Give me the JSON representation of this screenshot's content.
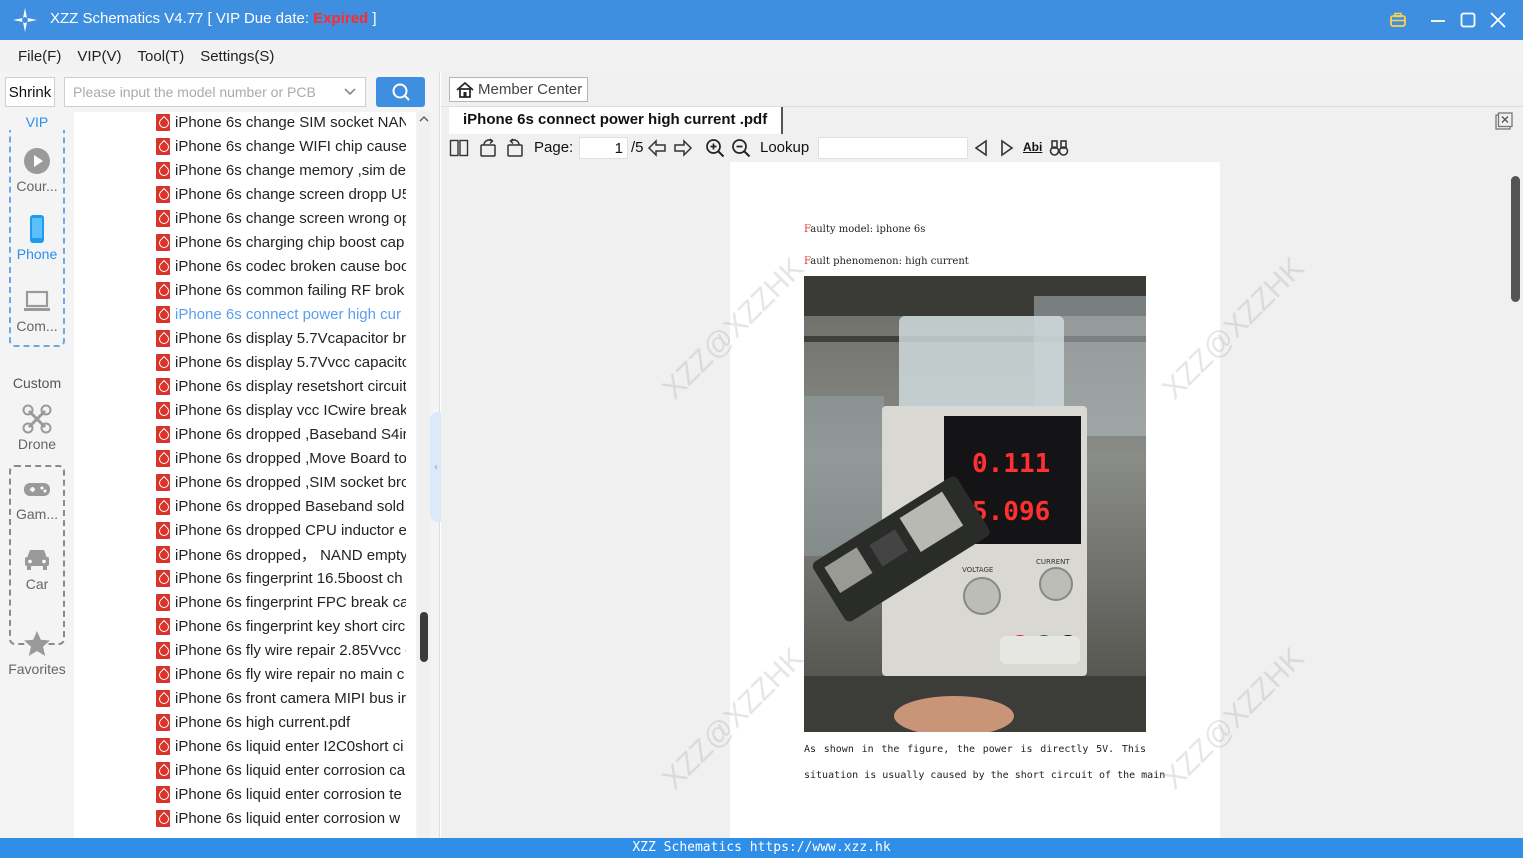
{
  "window": {
    "title_prefix": "XZZ Schematics V4.77 [ VIP Due date: ",
    "title_status": "Expired",
    "title_suffix": " ]"
  },
  "menu": [
    "File(F)",
    "VIP(V)",
    "Tool(T)",
    "Settings(S)"
  ],
  "search": {
    "shrink_label": "Shrink",
    "placeholder": "Please input the model number or PCB"
  },
  "rail": {
    "vip_label": "VIP",
    "custom_label": "Custom",
    "items": [
      {
        "label": "Cour...",
        "icon": "play-icon"
      },
      {
        "label": "Phone",
        "icon": "phone-icon"
      },
      {
        "label": "Com...",
        "icon": "laptop-icon"
      },
      {
        "label": "Drone",
        "icon": "drone-icon"
      },
      {
        "label": "Gam...",
        "icon": "gamepad-icon"
      },
      {
        "label": "Car",
        "icon": "car-icon"
      },
      {
        "label": "Favorites",
        "icon": "star-icon"
      }
    ]
  },
  "files": [
    "iPhone 6s change SIM socket NAN",
    "iPhone 6s change WIFI chip cause",
    "iPhone 6s change memory ,sim de",
    "iPhone 6s change screen dropp U5",
    "iPhone 6s change screen wrong op",
    "iPhone 6s charging chip boost cap",
    "iPhone 6s codec broken cause boo",
    "iPhone 6s common failing RF brok",
    "iPhone 6s connect power high cur",
    "iPhone 6s display 5.7Vcapacitor br",
    "iPhone 6s display 5.7Vvcc capacito",
    "iPhone 6s display resetshort circuit",
    "iPhone 6s display vcc ICwire break",
    "iPhone 6s dropped ,Baseband S4ir",
    "iPhone 6s dropped ,Move Board to",
    "iPhone 6s dropped ,SIM socket bro",
    "iPhone 6s dropped Baseband sold",
    "iPhone 6s dropped CPU inductor e",
    "iPhone 6s dropped， NAND empty",
    "iPhone 6s fingerprint 16.5boost ch",
    "iPhone 6s fingerprint FPC break ca",
    "iPhone 6s fingerprint key short circ",
    "iPhone 6s fly wire repair 2.85Vvcc c",
    "iPhone 6s fly wire repair no main c",
    "iPhone 6s front camera MIPI bus ir",
    "iPhone 6s high current.pdf",
    "iPhone 6s liquid enter I2C0short ci",
    "iPhone 6s liquid enter corrosion ca",
    "iPhone 6s liquid enter corrosion te",
    "iPhone 6s liquid enter corrosion w"
  ],
  "active_file_index": 8,
  "viewer": {
    "member_center": "Member Center",
    "tab_title": "iPhone 6s connect power high current .pdf",
    "page_label": "Page:",
    "page_current": "1",
    "page_total": "/5",
    "lookup_label": "Lookup",
    "abi_label": "Abi"
  },
  "document": {
    "line1_first": "F",
    "line1_rest": "aulty model: iphone 6s",
    "line2_first": "F",
    "line2_rest": "ault phenomenon: high current",
    "psu_voltage": "0.111",
    "psu_current": "5.096",
    "psu_voltage_label": "VOLTAGE",
    "psu_current_label": "CURRENT",
    "body1": "As shown in the figure, the power is directly 5V. This",
    "body2": "situation is usually caused by the short circuit of the main",
    "watermark": "XZZ@XZZHK"
  },
  "status": "XZZ Schematics https://www.xzz.hk",
  "colors": {
    "brand_blue": "#3f8fe0",
    "expired_red": "#ff2a2a",
    "active_link": "#5a9ff0",
    "pdf_red": "#d9342b"
  }
}
